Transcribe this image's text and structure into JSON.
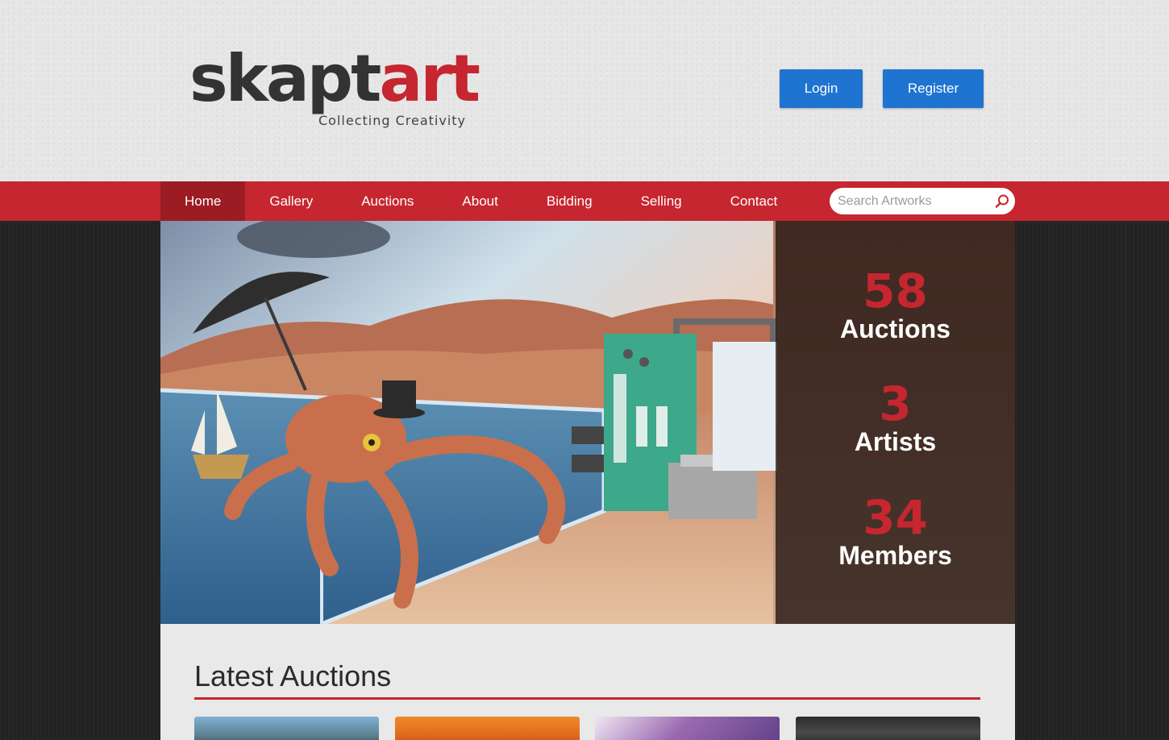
{
  "brand": {
    "name_part1": "skapt",
    "name_part2": "art",
    "tagline": "Collecting Creativity"
  },
  "header": {
    "login_label": "Login",
    "register_label": "Register"
  },
  "nav": {
    "items": [
      {
        "label": "Home",
        "active": true
      },
      {
        "label": "Gallery",
        "active": false
      },
      {
        "label": "Auctions",
        "active": false
      },
      {
        "label": "About",
        "active": false
      },
      {
        "label": "Bidding",
        "active": false
      },
      {
        "label": "Selling",
        "active": false
      },
      {
        "label": "Contact",
        "active": false
      }
    ],
    "search_placeholder": "Search Artworks",
    "search_icon": "search-icon"
  },
  "stats": [
    {
      "value": "58",
      "label": "Auctions"
    },
    {
      "value": "3",
      "label": "Artists"
    },
    {
      "value": "34",
      "label": "Members"
    }
  ],
  "latest": {
    "title": "Latest Auctions"
  },
  "colors": {
    "brand_red": "#c6262f",
    "nav_active": "#9b1c22",
    "button_blue": "#1e74d0",
    "header_bg": "#e6e6e6"
  }
}
